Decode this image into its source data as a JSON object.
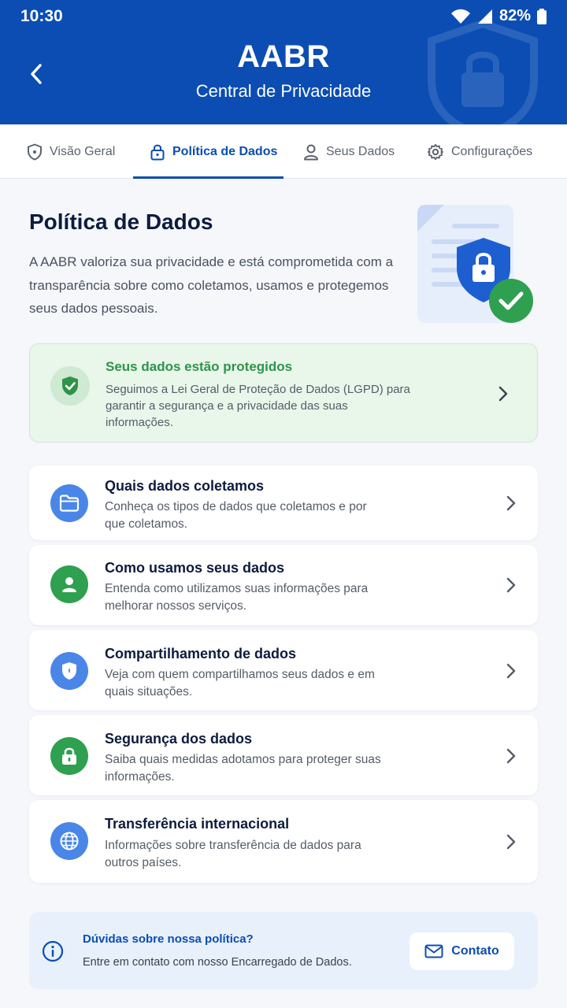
{
  "status": {
    "time": "10:30",
    "battery": "82%"
  },
  "header": {
    "title": "AABR",
    "subtitle": "Central de Privacidade"
  },
  "tabs": [
    {
      "label": "Visão Geral",
      "icon": "shield-icon",
      "active": false
    },
    {
      "label": "Política de Dados",
      "icon": "lock-icon",
      "active": true
    },
    {
      "label": "Seus Dados",
      "icon": "user-icon",
      "active": false
    },
    {
      "label": "Configurações",
      "icon": "gear-icon",
      "active": false
    }
  ],
  "main": {
    "title": "Política de Dados",
    "description": "A AABR valoriza sua privacidade e está comprometida com a transparência sobre como coletamos, usamos e protegemos seus dados pessoais."
  },
  "protection": {
    "title": "Seus dados estão protegidos",
    "text": "Seguimos a Lei Geral de Proteção de Dados (LGPD) para garantir a segurança e a privacidade das suas informações."
  },
  "items": [
    {
      "title": "Quais dados coletamos",
      "desc": "Conheça os tipos de dados que coletamos e por que coletamos.",
      "icon": "folder-icon",
      "color": "#4a86e8"
    },
    {
      "title": "Como usamos seus dados",
      "desc": "Entenda como utilizamos suas informações para melhorar nossos serviços.",
      "icon": "user-icon",
      "color": "#2ea04f"
    },
    {
      "title": "Compartilhamento de dados",
      "desc": "Veja com quem compartilhamos seus dados e em quais situações.",
      "icon": "shield-icon",
      "color": "#4a86e8"
    },
    {
      "title": "Segurança dos dados",
      "desc": "Saiba quais medidas adotamos para proteger suas informações.",
      "icon": "lock-icon",
      "color": "#2ea04f"
    },
    {
      "title": "Transferência internacional",
      "desc": "Informações sobre transferência de dados para outros países.",
      "icon": "globe-icon",
      "color": "#4a86e8"
    }
  ],
  "help": {
    "title": "Dúvidas sobre nossa política?",
    "text": "Entre em contato com nosso Encarregado de Dados.",
    "button": "Contato"
  },
  "colors": {
    "primary": "#0b4db3",
    "success": "#2e9448",
    "background": "#f5f7fb"
  }
}
